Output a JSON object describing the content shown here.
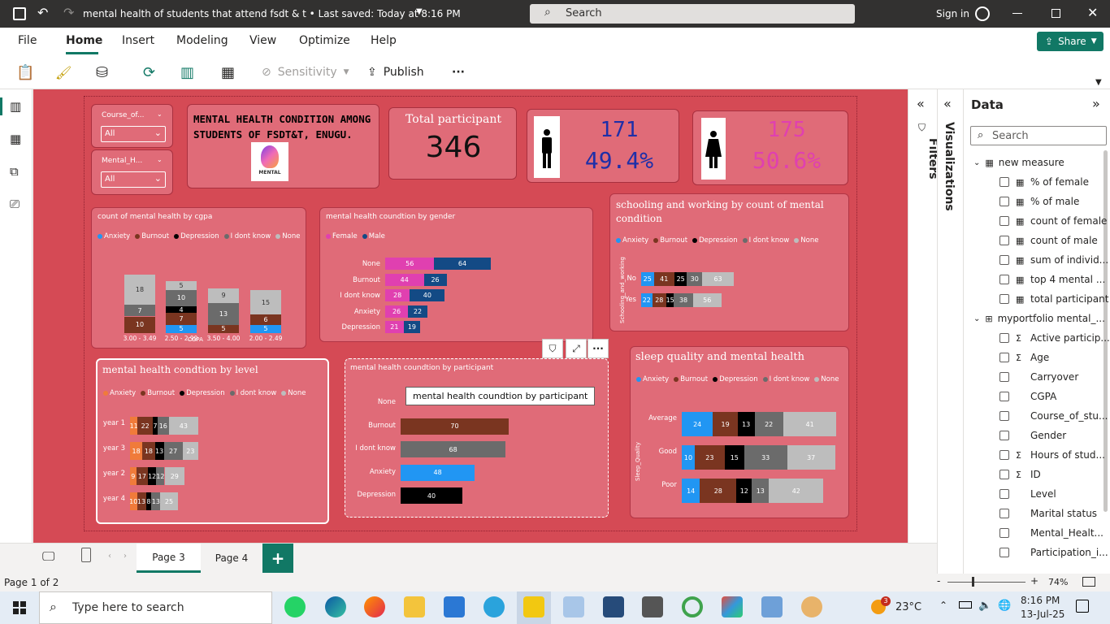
{
  "app": {
    "title": "mental health of students that attend fsdt & t • Last saved: Today at 8:16 PM",
    "search": "Search",
    "signin": "Sign in"
  },
  "tabs": [
    "File",
    "Home",
    "Insert",
    "Modeling",
    "View",
    "Optimize",
    "Help"
  ],
  "share": "Share",
  "toolbar": {
    "sensitivity": "Sensitivity",
    "publish": "Publish",
    "more": "···"
  },
  "slicers": [
    {
      "label": "Course_of...",
      "value": "All"
    },
    {
      "label": "Mental_H...",
      "value": "All"
    }
  ],
  "header": {
    "title": "MENTAL HEALTH CONDITION AMONG STUDENTS OF FSDT&T, ENUGU.",
    "logo_text": "MENTAL"
  },
  "kpi": {
    "label": "Total participant",
    "value": "346",
    "male_count": "171",
    "male_pct": "49.4%",
    "female_count": "175",
    "female_pct": "50.6%"
  },
  "legend_labels": [
    "Anxiety",
    "Burnout",
    "Depression",
    "I dont know",
    "None"
  ],
  "colors": {
    "anxiety": "#2196f3",
    "burnout": "#7a3520",
    "depression": "#000000",
    "idk": "#6b6b6b",
    "none": "#bdbdbd",
    "female": "#e040b0",
    "male": "#134a85",
    "level_anxiety": "#f07b3a",
    "canvas": "#d54a55",
    "card": "#e06b78"
  },
  "cgpa_chart": {
    "title": "count of mental health by cgpa",
    "xlabel": "CGPA",
    "categories": [
      "3.00 - 3.49",
      "2.50 - 2.99",
      "3.50 - 4.00",
      "2.00 - 2.49"
    ],
    "series": [
      {
        "name": "Anxiety",
        "values": [
          null,
          5,
          null,
          5
        ]
      },
      {
        "name": "Burnout",
        "values": [
          10,
          7,
          5,
          6
        ]
      },
      {
        "name": "Depression",
        "values": [
          null,
          4,
          null,
          null
        ]
      },
      {
        "name": "I dont know",
        "values": [
          7,
          10,
          13,
          null
        ]
      },
      {
        "name": "None",
        "values": [
          18,
          5,
          9,
          15
        ]
      }
    ]
  },
  "gender_chart": {
    "title": "mental health coundtion by gender",
    "legend": [
      "Female",
      "Male"
    ],
    "categories": [
      "None",
      "Burnout",
      "I dont know",
      "Anxiety",
      "Depression"
    ],
    "series": [
      {
        "name": "Female",
        "values": [
          56,
          44,
          28,
          26,
          21
        ]
      },
      {
        "name": "Male",
        "values": [
          64,
          26,
          40,
          22,
          19
        ]
      }
    ]
  },
  "schooling_chart": {
    "title": "schooling and working by count of mental condition",
    "ylabel": "Schooling_and_working",
    "categories": [
      "No",
      "Yes"
    ],
    "series": [
      {
        "name": "Anxiety",
        "values": [
          25,
          22
        ]
      },
      {
        "name": "Burnout",
        "values": [
          41,
          28
        ]
      },
      {
        "name": "Depression",
        "values": [
          25,
          15
        ]
      },
      {
        "name": "I dont know",
        "values": [
          30,
          38
        ]
      },
      {
        "name": "None",
        "values": [
          63,
          56
        ]
      }
    ]
  },
  "level_chart": {
    "title": "mental health condtion by level",
    "categories": [
      "year 1",
      "year 3",
      "year 2",
      "year 4"
    ],
    "series": [
      {
        "name": "Anxiety",
        "values": [
          11,
          18,
          9,
          10
        ]
      },
      {
        "name": "Burnout",
        "values": [
          22,
          18,
          17,
          13
        ]
      },
      {
        "name": "Depression",
        "values": [
          7,
          13,
          12,
          8
        ]
      },
      {
        "name": "I dont know",
        "values": [
          16,
          27,
          12,
          13
        ]
      },
      {
        "name": "None",
        "values": [
          43,
          23,
          29,
          25
        ]
      }
    ]
  },
  "participant_chart": {
    "title": "mental health coundtion by participant",
    "tooltip": "mental health coundtion by participant",
    "categories": [
      "None",
      "Burnout",
      "I dont know",
      "Anxiety",
      "Depression"
    ],
    "values": [
      null,
      70,
      68,
      48,
      40
    ]
  },
  "sleep_chart": {
    "title": "sleep quality and mental health",
    "ylabel": "Sleep_Quality",
    "categories": [
      "Average",
      "Good",
      "Poor"
    ],
    "series": [
      {
        "name": "Anxiety",
        "values": [
          24,
          10,
          14
        ]
      },
      {
        "name": "Burnout",
        "values": [
          19,
          23,
          28
        ]
      },
      {
        "name": "Depression",
        "values": [
          13,
          15,
          12
        ]
      },
      {
        "name": "I dont know",
        "values": [
          22,
          33,
          13
        ]
      },
      {
        "name": "None",
        "values": [
          41,
          37,
          42
        ]
      }
    ]
  },
  "filters": "Filters",
  "visualizations": "Visualizations",
  "data_pane": {
    "title": "Data",
    "search": "Search",
    "groups": [
      {
        "name": "new measure",
        "items": [
          "% of female",
          "% of male",
          "count of female",
          "count of male",
          "sum of individ...",
          "top 4 mental ...",
          "total participant"
        ]
      },
      {
        "name": "myportfolio mental_...",
        "items": [
          "Active particip...",
          "Age",
          "Carryover",
          "CGPA",
          "Course_of_stu...",
          "Gender",
          "Hours of stud...",
          "ID",
          "Level",
          "Marital status",
          "Mental_Healt...",
          "Participation_i..."
        ]
      }
    ]
  },
  "pages": [
    "Page 3",
    "Page 4"
  ],
  "status": {
    "page": "Page 1 of 2",
    "zoom": "74%"
  },
  "taskbar": {
    "search": "Type here to search",
    "temp": "23°C",
    "time": "8:16 PM",
    "date": "13-Jul-25",
    "badge": "3"
  }
}
